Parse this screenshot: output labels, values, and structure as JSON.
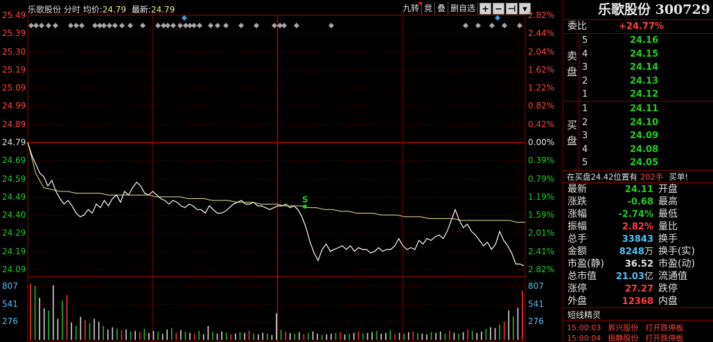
{
  "header": {
    "stock_name": "乐歌股份",
    "chart_kind": "分时",
    "avg_label": "均价:",
    "avg_value": "24.79",
    "last_label": "最新:",
    "last_value": "24.79"
  },
  "toolbar": {
    "items": [
      "九转",
      "竞",
      "叠",
      "删自选"
    ],
    "buttons": [
      "+",
      "−",
      "⊣",
      "▾"
    ]
  },
  "y_axis": {
    "price_labels": [
      "25.49",
      "25.39",
      "25.30",
      "25.19",
      "25.09",
      "24.99",
      "24.89",
      "24.79",
      "24.69",
      "24.59",
      "24.49",
      "24.40",
      "24.29",
      "24.19",
      "24.09"
    ],
    "pct_labels": [
      "2.82%",
      "2.44%",
      "2.04%",
      "1.62%",
      "1.22%",
      "0.82%",
      "0.42%",
      "0.00%",
      "0.39%",
      "0.79%",
      "1.19%",
      "1.59%",
      "2.01%",
      "2.41%",
      "2.82%"
    ],
    "volume_labels": [
      "807",
      "541",
      "276"
    ]
  },
  "chart_data": {
    "type": "line",
    "title": "乐歌股份 分时",
    "prev_close": 24.79,
    "ylim": [
      24.09,
      25.49
    ],
    "series": [
      {
        "name": "price",
        "color": "#ffffff",
        "values": [
          24.79,
          24.72,
          24.67,
          24.62,
          24.6,
          24.55,
          24.58,
          24.52,
          24.48,
          24.45,
          24.47,
          24.44,
          24.4,
          24.38,
          24.39,
          24.42,
          24.4,
          24.45,
          24.43,
          24.47,
          24.44,
          24.48,
          24.5,
          24.46,
          24.52,
          24.5,
          24.54,
          24.57,
          24.55,
          24.51,
          24.5,
          24.52,
          24.5,
          24.48,
          24.47,
          24.45,
          24.47,
          24.46,
          24.44,
          24.43,
          24.45,
          24.44,
          24.42,
          24.42,
          24.4,
          24.44,
          24.42,
          24.4,
          24.4,
          24.41,
          24.43,
          24.45,
          24.46,
          24.47,
          24.45,
          24.45,
          24.46,
          24.44,
          24.44,
          24.43,
          24.42,
          24.43,
          24.44,
          24.44,
          24.45,
          24.43,
          24.44,
          24.42,
          24.38,
          24.32,
          24.24,
          24.18,
          24.14,
          24.2,
          24.23,
          24.19,
          24.2,
          24.21,
          24.22,
          24.2,
          24.22,
          24.19,
          24.21,
          24.2,
          24.2,
          24.18,
          24.19,
          24.21,
          24.19,
          24.2,
          24.2,
          24.22,
          24.26,
          24.22,
          24.2,
          24.21,
          24.2,
          24.25,
          24.23,
          24.26,
          24.25,
          24.27,
          24.28,
          24.26,
          24.3,
          24.36,
          24.42,
          24.36,
          24.32,
          24.34,
          24.3,
          24.28,
          24.25,
          24.22,
          24.24,
          24.2,
          24.23,
          24.3,
          24.25,
          24.22,
          24.18,
          24.12,
          24.12,
          24.11
        ]
      },
      {
        "name": "avg",
        "color": "#e8e89a",
        "values": [
          24.79,
          24.62,
          24.54,
          24.53,
          24.52,
          24.52,
          24.51,
          24.51,
          24.51,
          24.51,
          24.5,
          24.5,
          24.5,
          24.5,
          24.5,
          24.5,
          24.49,
          24.49,
          24.49,
          24.49,
          24.48,
          24.48,
          24.48,
          24.47,
          24.47,
          24.47,
          24.46,
          24.46,
          24.46,
          24.45,
          24.45,
          24.45,
          24.44,
          24.44,
          24.44,
          24.43,
          24.43,
          24.42,
          24.42,
          24.41,
          24.41,
          24.4,
          24.4,
          24.4,
          24.39,
          24.39,
          24.39,
          24.38,
          24.38,
          24.38,
          24.37,
          24.37,
          24.37,
          24.37,
          24.36,
          24.36,
          24.36,
          24.36,
          24.36,
          24.36,
          24.36,
          24.35,
          24.35
        ]
      }
    ],
    "volume": [
      807,
      770,
      600,
      450,
      420,
      780,
      300,
      560,
      640,
      250,
      200,
      330,
      280,
      240,
      300,
      260,
      200,
      150,
      180,
      160,
      140,
      150,
      120,
      130,
      110,
      160,
      100,
      130,
      120,
      90,
      150,
      170,
      100,
      140,
      120,
      100,
      90,
      130,
      80,
      200,
      110,
      90,
      120,
      100,
      80,
      90,
      110,
      100,
      130,
      90,
      80,
      100,
      90,
      70,
      380,
      140,
      120,
      100,
      90,
      110,
      80,
      100,
      120,
      90,
      70,
      80,
      90,
      100,
      110,
      80,
      90,
      100,
      120,
      90,
      100,
      110,
      130,
      90,
      100,
      140,
      80,
      100,
      90,
      110,
      120,
      100,
      90,
      80,
      110,
      100,
      120,
      90,
      130,
      100,
      90,
      110,
      150,
      130,
      100,
      120,
      160,
      180,
      170,
      220,
      260,
      420,
      330,
      460,
      700
    ]
  },
  "panel": {
    "title": "乐歌股份 300729",
    "weibi_label": "委比",
    "weibi_value": "+24.77%",
    "sell_label": [
      "卖",
      "盘"
    ],
    "buy_label": [
      "买",
      "盘"
    ],
    "sell": [
      {
        "lvl": "5",
        "px": "24.16"
      },
      {
        "lvl": "4",
        "px": "24.15"
      },
      {
        "lvl": "3",
        "px": "24.14"
      },
      {
        "lvl": "2",
        "px": "24.13"
      },
      {
        "lvl": "1",
        "px": "24.12"
      }
    ],
    "buy": [
      {
        "lvl": "1",
        "px": "24.11"
      },
      {
        "lvl": "2",
        "px": "24.10"
      },
      {
        "lvl": "3",
        "px": "24.09"
      },
      {
        "lvl": "4",
        "px": "24.08"
      },
      {
        "lvl": "5",
        "px": "24.05"
      }
    ],
    "trade_text": "在买盘24.42位置有",
    "trade_vol": "202手",
    "trade_type": "买单!",
    "quotes": [
      {
        "label": "最新",
        "value": "24.11",
        "unit": "",
        "color": "green",
        "label2": "开盘"
      },
      {
        "label": "涨跌",
        "value": "-0.68",
        "unit": "",
        "color": "green",
        "label2": "最高"
      },
      {
        "label": "涨幅",
        "value": "-2.74%",
        "unit": "",
        "color": "green",
        "label2": "最低"
      },
      {
        "label": "振幅",
        "value": "2.82%",
        "unit": "",
        "color": "red",
        "label2": "量比"
      },
      {
        "label": "总手",
        "value": "33843",
        "unit": "",
        "color": "cyan",
        "label2": "换手"
      },
      {
        "label": "金额",
        "value": "8248",
        "unit": "万",
        "color": "cyan",
        "label2": "换手(实)"
      },
      {
        "label": "市盈(静)",
        "value": "36.52",
        "unit": "",
        "color": "white",
        "label2": "市盈(动)"
      },
      {
        "label": "总市值",
        "value": "21.03",
        "unit": "亿",
        "color": "cyan",
        "label2": "流通值"
      },
      {
        "label": "涨停",
        "value": "27.27",
        "unit": "",
        "color": "red",
        "label2": "跌停"
      },
      {
        "label": "外盘",
        "value": "12368",
        "unit": "",
        "color": "red",
        "label2": "内盘"
      }
    ],
    "elf_title": "短线精灵",
    "elf_rows": [
      {
        "time": "15:00:03",
        "name": "昇兴股份",
        "event": "打开跌停板"
      },
      {
        "time": "15:00:04",
        "name": "振静股份",
        "event": "打开跌停板"
      }
    ]
  }
}
